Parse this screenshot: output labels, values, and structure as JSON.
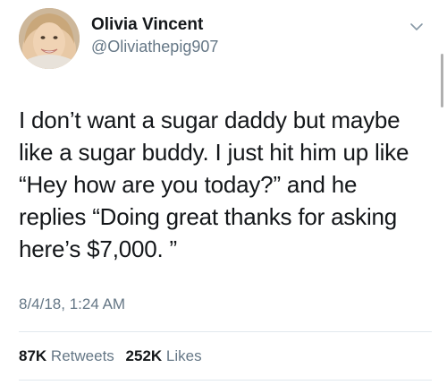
{
  "tweet": {
    "author": {
      "display_name": "Olivia Vincent",
      "handle": "@Oliviathepig907"
    },
    "text_lines": [
      "I don’t want a sugar daddy but maybe",
      "like a sugar buddy.  I just hit him up like",
      "“Hey how are you today?” and he",
      "replies “Doing great thanks for asking",
      "here’s $7,000. ”"
    ],
    "timestamp": "8/4/18, 1:24 AM",
    "stats": {
      "retweets_count": "87K",
      "retweets_label": "Retweets",
      "likes_count": "252K",
      "likes_label": "Likes"
    }
  },
  "icons": {
    "menu": "chevron-down-icon"
  },
  "colors": {
    "primary_text": "#14171a",
    "secondary_text": "#657786",
    "divider": "#e1e8ed"
  }
}
